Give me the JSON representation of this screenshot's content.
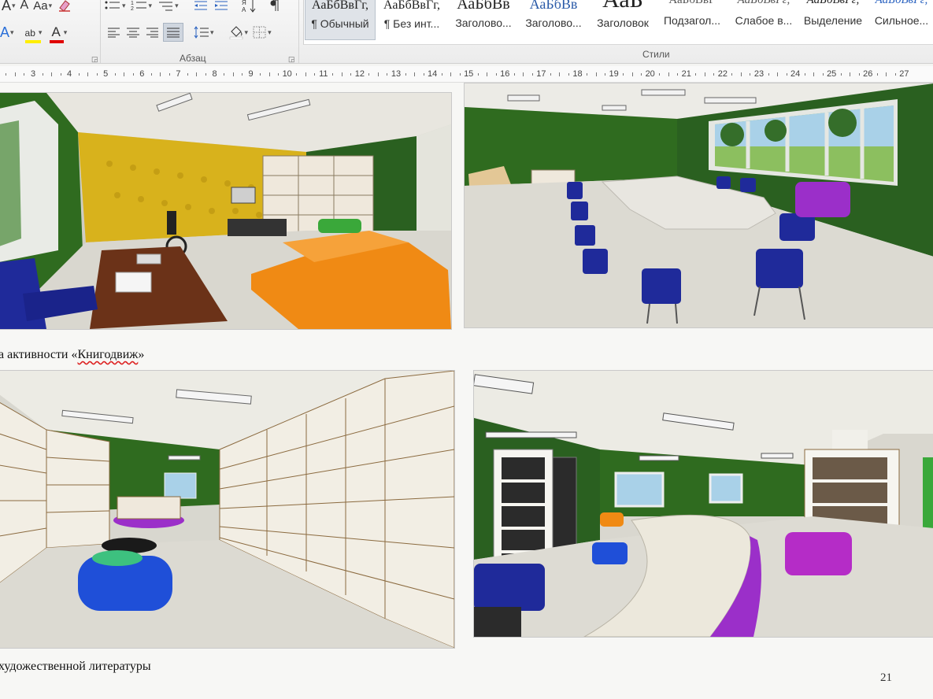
{
  "ribbon": {
    "font_group": {
      "row1": [
        "A",
        "A",
        "Aa"
      ],
      "row2": [
        "A",
        "ab",
        "A"
      ]
    },
    "paragraph_group": {
      "label": "Абзац"
    },
    "styles_group": {
      "label": "Стили",
      "tiles": [
        {
          "preview": "АаБбВвГг,",
          "name": "¶ Обычный"
        },
        {
          "preview": "АаБбВвГг,",
          "name": "¶ Без инт..."
        },
        {
          "preview": "АаБбВв",
          "name": "Заголово..."
        },
        {
          "preview": "АаБбВв",
          "name": "Заголово..."
        },
        {
          "preview": "АаБ",
          "name": "Заголовок"
        },
        {
          "preview": "АаБбВвГ",
          "name": "Подзагол..."
        },
        {
          "preview": "АаБбВвГг,",
          "name": "Слабое в..."
        },
        {
          "preview": "АаБбВвГг,",
          "name": "Выделение"
        },
        {
          "preview": "АаБбВвГг,",
          "name": "Сильное..."
        }
      ]
    }
  },
  "ruler": {
    "numbers": [
      "3",
      "4",
      "5",
      "6",
      "7",
      "8",
      "9",
      "10",
      "11",
      "12",
      "13",
      "14",
      "15",
      "16",
      "17",
      "18",
      "19",
      "20",
      "21",
      "22",
      "23",
      "24",
      "25",
      "26",
      "27"
    ]
  },
  "document": {
    "caption_top": {
      "prefix": "а активности «",
      "word": "Книгодвиж",
      "suffix": "»"
    },
    "caption_bottom": "художественной литературы",
    "page_number": "21"
  },
  "colors": {
    "wall_green": "#2f6b1f",
    "wall_yellow": "#d8b21c",
    "sofa_orange": "#f08a14",
    "chair_blue": "#1f2a9a",
    "pouf_blue": "#1f4fd8",
    "accent_purple": "#9b2fc9",
    "floor": "#d9d7cf"
  }
}
